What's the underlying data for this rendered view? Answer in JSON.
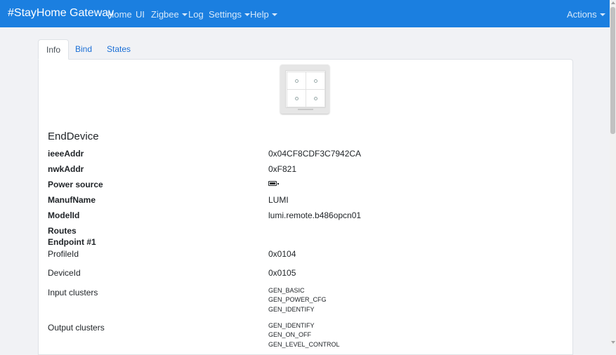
{
  "navbar": {
    "brand": "#StayHome Gateway",
    "home": "Home",
    "ui": "UI",
    "zigbee": "Zigbee",
    "log": "Log",
    "settings": "Settings",
    "help": "Help",
    "actions": "Actions"
  },
  "tabs": {
    "info": "Info",
    "bind": "Bind",
    "states": "States"
  },
  "device": {
    "type": "EndDevice",
    "fields": {
      "ieee_label": "ieeeAddr",
      "ieee_value": "0x04CF8CDF3C7942CA",
      "nwk_label": "nwkAddr",
      "nwk_value": "0xF821",
      "power_label": "Power source",
      "power_icon": "battery-full-icon",
      "manuf_label": "ManufName",
      "manuf_value": "LUMI",
      "model_label": "ModelId",
      "model_value": "lumi.remote.b486opcn01"
    },
    "routes_label": "Routes",
    "endpoint": {
      "title": "Endpoint #1",
      "profile_label": "ProfileId",
      "profile_value": "0x0104",
      "deviceid_label": "DeviceId",
      "deviceid_value": "0x0105",
      "input_label": "Input clusters",
      "input_clusters": [
        "GEN_BASIC",
        "GEN_POWER_CFG",
        "GEN_IDENTIFY"
      ],
      "output_label": "Output clusters",
      "output_clusters": [
        "GEN_IDENTIFY",
        "GEN_ON_OFF",
        "GEN_LEVEL_CONTROL"
      ]
    }
  }
}
